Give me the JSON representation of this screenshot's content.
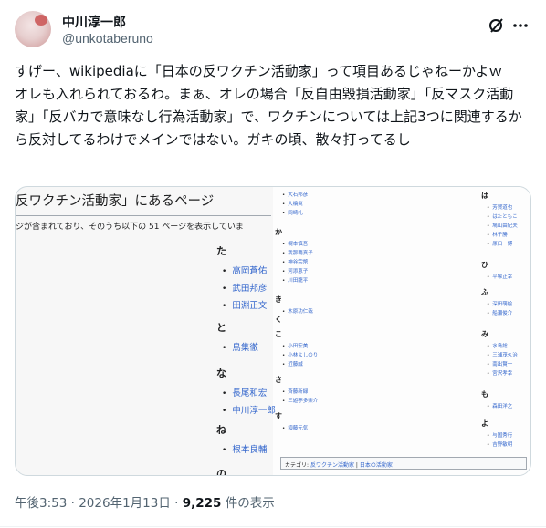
{
  "user": {
    "display_name": "中川淳一郎",
    "handle": "@unkotaberuno"
  },
  "tweet": {
    "text": "すげー、wikipediaに「日本の反ワクチン活動家」って項目あるじゃねーかよｗ　オレも入れられておるわ。まぁ、オレの場合「反自由毀損活動家」「反マスク活動家」「反バカで意味なし行為活動家」で、ワクチンについては上記3つに関連するから反対してるわけでメインではない。ガキの頃、散々打ってるし"
  },
  "icons": {
    "grok": "grok-icon",
    "more": "more-icon"
  },
  "media": {
    "page_title": "反ワクチン活動家」にあるページ",
    "page_subtitle": "ジが含まれており、そのうち以下の 51 ページを表示していま",
    "left_sections": [
      {
        "letter": "た",
        "entries": [
          "高岡蒼佑",
          "武田邦彦",
          "田淵正文"
        ]
      },
      {
        "letter": "と",
        "entries": [
          "鳥集徹"
        ]
      },
      {
        "letter": "な",
        "entries": [
          "長尾和宏",
          "中川淳一郎"
        ]
      },
      {
        "letter": "ね",
        "entries": [
          "根本良輔"
        ]
      },
      {
        "letter": "の",
        "entries": []
      }
    ],
    "mid_top_entries": [
      "大石邦彦",
      "大橋眞",
      "岡崎札"
    ],
    "mid_sections": [
      {
        "letter": "か",
        "entries": [
          "梶本慎吾",
          "我那覇真子",
          "神谷宗幣",
          "河添恵子",
          "川田龍平"
        ]
      },
      {
        "letter": "き",
        "entries": [
          "木原功仁哉"
        ]
      },
      {
        "letter": "く",
        "entries": []
      },
      {
        "letter": "こ",
        "entries": [
          "小田宏美",
          "小林よしのり",
          "近藤誠"
        ]
      },
      {
        "letter": "さ",
        "entries": [
          "斉藤新緑",
          "三遊亭多楽介"
        ]
      },
      {
        "letter": "す",
        "entries": [
          "須藤元気"
        ]
      }
    ],
    "right_sections": [
      {
        "letter": "は",
        "entries": [
          "芳賀道也",
          "はたともこ",
          "鳩山由紀夫",
          "林千勝",
          "原口一博"
        ]
      },
      {
        "letter": "ひ",
        "entries": [
          "平塚正幸"
        ]
      },
      {
        "letter": "ふ",
        "entries": [
          "深田萌絵",
          "船瀬俊介"
        ]
      },
      {
        "letter": "み",
        "entries": [
          "水島総",
          "三浦茂久治",
          "南出賢一",
          "宮沢孝幸"
        ]
      },
      {
        "letter": "も",
        "entries": [
          "森田洋之"
        ]
      },
      {
        "letter": "よ",
        "entries": [
          "与国秀行",
          "吉野敏明"
        ]
      }
    ],
    "category_label": "カテゴリ:",
    "category_links": [
      "反ワクチン活動家",
      "日本の活動家"
    ]
  },
  "meta": {
    "time": "午後3:53",
    "sep": "·",
    "date": "2026年1月13日",
    "views": "9,225",
    "views_suffix": "件の表示"
  }
}
